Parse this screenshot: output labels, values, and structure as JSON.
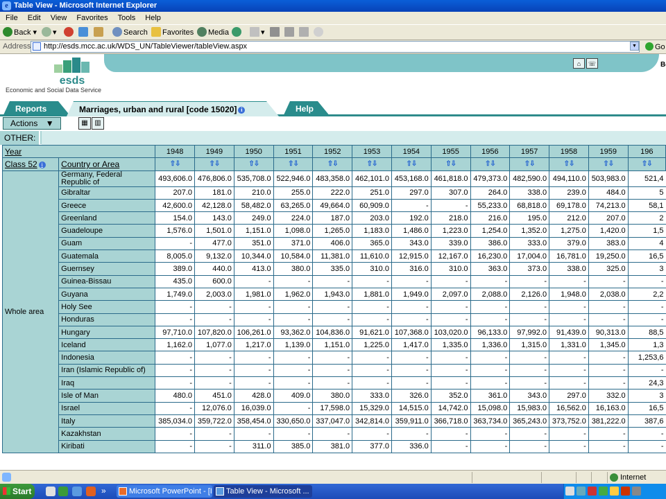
{
  "window": {
    "title": "Table View - Microsoft Internet Explorer"
  },
  "menu": [
    "File",
    "Edit",
    "View",
    "Favorites",
    "Tools",
    "Help"
  ],
  "toolbar": {
    "back": "Back",
    "search": "Search",
    "favorites": "Favorites",
    "media": "Media"
  },
  "address": {
    "label": "Address",
    "url": "http://esds.mcc.ac.uk/WDS_UN/TableViewer/tableView.aspx",
    "go": "Go"
  },
  "site": {
    "logo": "esds",
    "tagline": "Economic and Social Data Service",
    "header_text": "Be"
  },
  "tabs": {
    "reports": "Reports",
    "table": "Marriages, urban and rural [code 15020]",
    "help": "Help"
  },
  "actions": {
    "label": "Actions"
  },
  "other": {
    "label": "OTHER:"
  },
  "table": {
    "year_label": "Year",
    "class_label": "Class 52",
    "country_label": "Country or Area",
    "area_label": "Whole area",
    "years": [
      "1948",
      "1949",
      "1950",
      "1951",
      "1952",
      "1953",
      "1954",
      "1955",
      "1956",
      "1957",
      "1958",
      "1959",
      "196"
    ],
    "sort_glyph": "⇧⇩",
    "rows": [
      {
        "country": "Germany, Federal Republic of",
        "values": [
          "493,606.0",
          "476,806.0",
          "535,708.0",
          "522,946.0",
          "483,358.0",
          "462,101.0",
          "453,168.0",
          "461,818.0",
          "479,373.0",
          "482,590.0",
          "494,110.0",
          "503,983.0",
          "521,4"
        ]
      },
      {
        "country": "Gibraltar",
        "values": [
          "207.0",
          "181.0",
          "210.0",
          "255.0",
          "222.0",
          "251.0",
          "297.0",
          "307.0",
          "264.0",
          "338.0",
          "239.0",
          "484.0",
          "5"
        ]
      },
      {
        "country": "Greece",
        "values": [
          "42,600.0",
          "42,128.0",
          "58,482.0",
          "63,265.0",
          "49,664.0",
          "60,909.0",
          "-",
          "-",
          "55,233.0",
          "68,818.0",
          "69,178.0",
          "74,213.0",
          "58,1"
        ]
      },
      {
        "country": "Greenland",
        "values": [
          "154.0",
          "143.0",
          "249.0",
          "224.0",
          "187.0",
          "203.0",
          "192.0",
          "218.0",
          "216.0",
          "195.0",
          "212.0",
          "207.0",
          "2"
        ]
      },
      {
        "country": "Guadeloupe",
        "values": [
          "1,576.0",
          "1,501.0",
          "1,151.0",
          "1,098.0",
          "1,265.0",
          "1,183.0",
          "1,486.0",
          "1,223.0",
          "1,254.0",
          "1,352.0",
          "1,275.0",
          "1,420.0",
          "1,5"
        ]
      },
      {
        "country": "Guam",
        "values": [
          "-",
          "477.0",
          "351.0",
          "371.0",
          "406.0",
          "365.0",
          "343.0",
          "339.0",
          "386.0",
          "333.0",
          "379.0",
          "383.0",
          "4"
        ]
      },
      {
        "country": "Guatemala",
        "values": [
          "8,005.0",
          "9,132.0",
          "10,344.0",
          "10,584.0",
          "11,381.0",
          "11,610.0",
          "12,915.0",
          "12,167.0",
          "16,230.0",
          "17,004.0",
          "16,781.0",
          "19,250.0",
          "16,5"
        ]
      },
      {
        "country": "Guernsey",
        "values": [
          "389.0",
          "440.0",
          "413.0",
          "380.0",
          "335.0",
          "310.0",
          "316.0",
          "310.0",
          "363.0",
          "373.0",
          "338.0",
          "325.0",
          "3"
        ]
      },
      {
        "country": "Guinea-Bissau",
        "values": [
          "435.0",
          "600.0",
          "-",
          "-",
          "-",
          "-",
          "-",
          "-",
          "-",
          "-",
          "-",
          "-",
          "-"
        ]
      },
      {
        "country": "Guyana",
        "values": [
          "1,749.0",
          "2,003.0",
          "1,981.0",
          "1,962.0",
          "1,943.0",
          "1,881.0",
          "1,949.0",
          "2,097.0",
          "2,088.0",
          "2,126.0",
          "1,948.0",
          "2,038.0",
          "2,2"
        ]
      },
      {
        "country": "Holy See",
        "values": [
          "-",
          "-",
          "-",
          "-",
          "-",
          "-",
          "-",
          "-",
          "-",
          "-",
          "-",
          "-",
          "-"
        ]
      },
      {
        "country": "Honduras",
        "values": [
          "-",
          "-",
          "-",
          "-",
          "-",
          "-",
          "-",
          "-",
          "-",
          "-",
          "-",
          "-",
          "-"
        ]
      },
      {
        "country": "Hungary",
        "values": [
          "97,710.0",
          "107,820.0",
          "106,261.0",
          "93,362.0",
          "104,836.0",
          "91,621.0",
          "107,368.0",
          "103,020.0",
          "96,133.0",
          "97,992.0",
          "91,439.0",
          "90,313.0",
          "88,5"
        ]
      },
      {
        "country": "Iceland",
        "values": [
          "1,162.0",
          "1,077.0",
          "1,217.0",
          "1,139.0",
          "1,151.0",
          "1,225.0",
          "1,417.0",
          "1,335.0",
          "1,336.0",
          "1,315.0",
          "1,331.0",
          "1,345.0",
          "1,3"
        ]
      },
      {
        "country": "Indonesia",
        "values": [
          "-",
          "-",
          "-",
          "-",
          "-",
          "-",
          "-",
          "-",
          "-",
          "-",
          "-",
          "-",
          "1,253,6"
        ]
      },
      {
        "country": "Iran (Islamic Republic of)",
        "values": [
          "-",
          "-",
          "-",
          "-",
          "-",
          "-",
          "-",
          "-",
          "-",
          "-",
          "-",
          "-",
          "-"
        ]
      },
      {
        "country": "Iraq",
        "values": [
          "-",
          "-",
          "-",
          "-",
          "-",
          "-",
          "-",
          "-",
          "-",
          "-",
          "-",
          "-",
          "24,3"
        ]
      },
      {
        "country": "Isle of Man",
        "values": [
          "480.0",
          "451.0",
          "428.0",
          "409.0",
          "380.0",
          "333.0",
          "326.0",
          "352.0",
          "361.0",
          "343.0",
          "297.0",
          "332.0",
          "3"
        ]
      },
      {
        "country": "Israel",
        "values": [
          "-",
          "12,076.0",
          "16,039.0",
          "-",
          "17,598.0",
          "15,329.0",
          "14,515.0",
          "14,742.0",
          "15,098.0",
          "15,983.0",
          "16,562.0",
          "16,163.0",
          "16,5"
        ]
      },
      {
        "country": "Italy",
        "values": [
          "385,034.0",
          "359,722.0",
          "358,454.0",
          "330,650.0",
          "337,047.0",
          "342,814.0",
          "359,911.0",
          "366,718.0",
          "363,734.0",
          "365,243.0",
          "373,752.0",
          "381,222.0",
          "387,6"
        ]
      },
      {
        "country": "Kazakhstan",
        "values": [
          "-",
          "-",
          "-",
          "-",
          "-",
          "-",
          "-",
          "-",
          "-",
          "-",
          "-",
          "-",
          "-"
        ]
      },
      {
        "country": "Kiribati",
        "values": [
          "-",
          "-",
          "311.0",
          "385.0",
          "381.0",
          "377.0",
          "336.0",
          "-",
          "-",
          "-",
          "-",
          "-",
          "-"
        ]
      }
    ]
  },
  "status": {
    "zone": "Internet"
  },
  "taskbar": {
    "start": "Start",
    "overflow": "»",
    "tasks": [
      "Microsoft PowerPoint - [I...",
      "Table View - Microsoft ..."
    ]
  }
}
